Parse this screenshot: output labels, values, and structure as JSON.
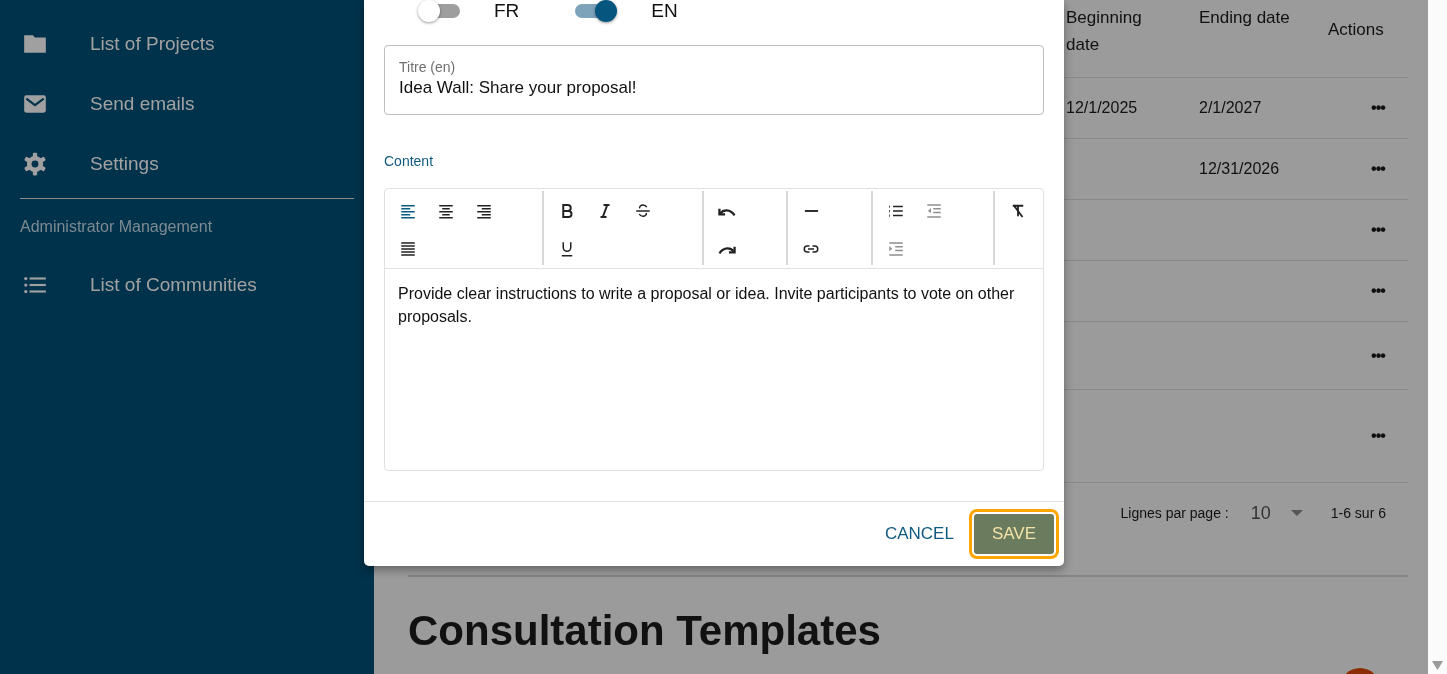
{
  "sidebar": {
    "items": [
      {
        "kind": "folder",
        "label": "List of Projects"
      },
      {
        "kind": "mail",
        "label": "Send emails"
      },
      {
        "kind": "gear",
        "label": "Settings"
      }
    ],
    "section_title": "Administrator Management",
    "admin_items": [
      {
        "kind": "list",
        "label": "List of Communities"
      }
    ]
  },
  "table": {
    "columns": [
      "Beginning date",
      "Ending date",
      "Actions"
    ],
    "rows": [
      {
        "beginning_date": "12/1/2025",
        "ending_date": "2/1/2027",
        "actions": "•••"
      },
      {
        "ending_date": "12/31/2026",
        "actions": "•••"
      },
      {
        "actions": "•••"
      },
      {
        "actions": "•••"
      },
      {
        "actions": "•••"
      },
      {
        "actions": "•••"
      }
    ],
    "pagination": {
      "rows_per_page_label": "Lignes par page :",
      "rows_per_page": "10",
      "range": "1-6 sur 6"
    }
  },
  "heading": "Consultation Templates",
  "dialog": {
    "languages": [
      {
        "label": "FR",
        "on": false
      },
      {
        "label": "EN",
        "on": true
      }
    ],
    "title_field": {
      "label": "Titre (en)",
      "value": "Idea Wall: Share your proposal!"
    },
    "content_label": "Content",
    "toolbar": [
      {
        "rows": [
          [
            {
              "kind": "align-left",
              "active": true,
              "disabled": false
            },
            {
              "kind": "align-center",
              "active": false,
              "disabled": false
            },
            {
              "kind": "align-right",
              "active": false,
              "disabled": false
            }
          ],
          [
            {
              "kind": "justify",
              "active": false,
              "disabled": false
            }
          ]
        ]
      },
      {
        "rows": [
          [
            {
              "kind": "bold",
              "active": false,
              "disabled": false
            },
            {
              "kind": "italic",
              "active": false,
              "disabled": false
            },
            {
              "kind": "strike",
              "active": false,
              "disabled": false
            }
          ],
          [
            {
              "kind": "underline",
              "active": false,
              "disabled": false
            }
          ]
        ]
      },
      {
        "rows": [
          [
            {
              "kind": "undo",
              "active": false,
              "disabled": false
            }
          ],
          [
            {
              "kind": "redo",
              "active": false,
              "disabled": false
            }
          ]
        ]
      },
      {
        "rows": [
          [
            {
              "kind": "rule",
              "active": false,
              "disabled": false
            }
          ],
          [
            {
              "kind": "link",
              "active": false,
              "disabled": false
            }
          ]
        ]
      },
      {
        "rows": [
          [
            {
              "kind": "bullets",
              "active": false,
              "disabled": false
            },
            {
              "kind": "outdent",
              "active": false,
              "disabled": true
            }
          ],
          [
            {
              "kind": "indent",
              "active": false,
              "disabled": true
            }
          ]
        ]
      },
      {
        "rows": [
          [
            {
              "kind": "clear",
              "active": false,
              "disabled": false
            }
          ]
        ]
      }
    ],
    "content": "Provide clear instructions to write a proposal or idea. Invite participants to vote on other proposals.",
    "buttons": [
      {
        "kind": "text",
        "label": "CANCEL",
        "focused": false
      },
      {
        "kind": "filled",
        "label": "SAVE",
        "focused": true
      }
    ]
  }
}
